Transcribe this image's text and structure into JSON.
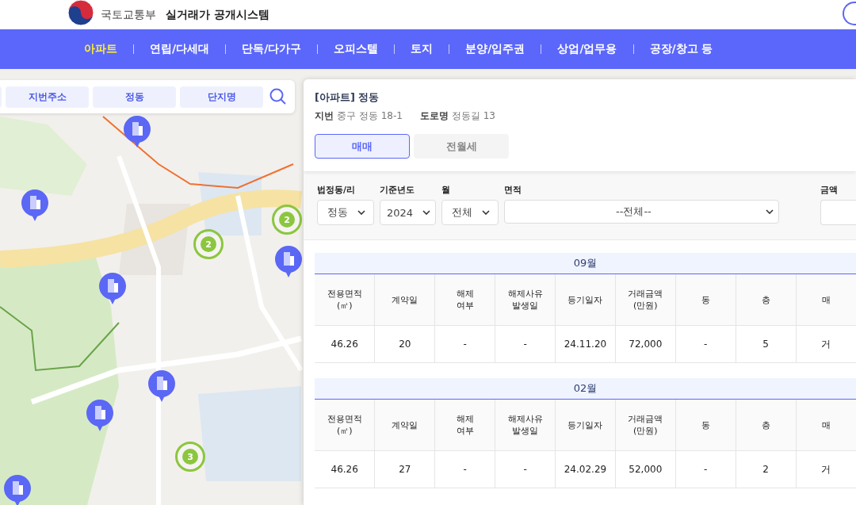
{
  "header": {
    "ministry": "국토교통부",
    "system": "실거래가 공개시스템"
  },
  "nav": [
    {
      "label": "아파트",
      "selected": true
    },
    {
      "label": "연립/다세대",
      "selected": false
    },
    {
      "label": "단독/다가구",
      "selected": false
    },
    {
      "label": "오피스텔",
      "selected": false
    },
    {
      "label": "토지",
      "selected": false
    },
    {
      "label": "분양/입주권",
      "selected": false
    },
    {
      "label": "상업/업무용",
      "selected": false
    },
    {
      "label": "공장/창고 등",
      "selected": false
    }
  ],
  "map": {
    "kind": "picture",
    "clusters": [
      {
        "count": "2"
      },
      {
        "count": "2"
      },
      {
        "count": "3"
      }
    ]
  },
  "search_tabs": [
    {
      "label": "지번주소"
    },
    {
      "label": "정동"
    },
    {
      "label": "단지명"
    }
  ],
  "detail": {
    "title": "[아파트] 정동",
    "jibun_label": "지번",
    "jibun": "중구 정동 18-1",
    "road_label": "도로명",
    "road": "정동길 13",
    "tabs": [
      {
        "label": "매매",
        "selected": true
      },
      {
        "label": "전월세",
        "selected": false
      }
    ],
    "filters": [
      {
        "kind": "select",
        "label": "법정동/리",
        "value": "정동"
      },
      {
        "kind": "select",
        "label": "기준년도",
        "value": "2024"
      },
      {
        "kind": "select",
        "label": "월",
        "value": "전체"
      },
      {
        "kind": "select",
        "label": "면적",
        "value": "--전체--"
      },
      {
        "kind": "input",
        "label": "금액"
      }
    ],
    "months": [
      {
        "month": "09월",
        "columns": [
          "전용면적\n(㎡)",
          "계약일",
          "해제\n여부",
          "해제사유\n발생일",
          "등기일자",
          "거래금액\n(만원)",
          "동",
          "층",
          "매"
        ],
        "rows": [
          [
            "46.26",
            "20",
            "-",
            "-",
            "24.11.20",
            "72,000",
            "-",
            "5",
            "거"
          ]
        ]
      },
      {
        "month": "02월",
        "columns": [
          "전용면적\n(㎡)",
          "계약일",
          "해제\n여부",
          "해제사유\n발생일",
          "등기일자",
          "거래금액\n(만원)",
          "동",
          "층",
          "매"
        ],
        "rows": [
          [
            "46.26",
            "27",
            "-",
            "-",
            "24.02.29",
            "52,000",
            "-",
            "2",
            "거"
          ]
        ]
      }
    ]
  }
}
